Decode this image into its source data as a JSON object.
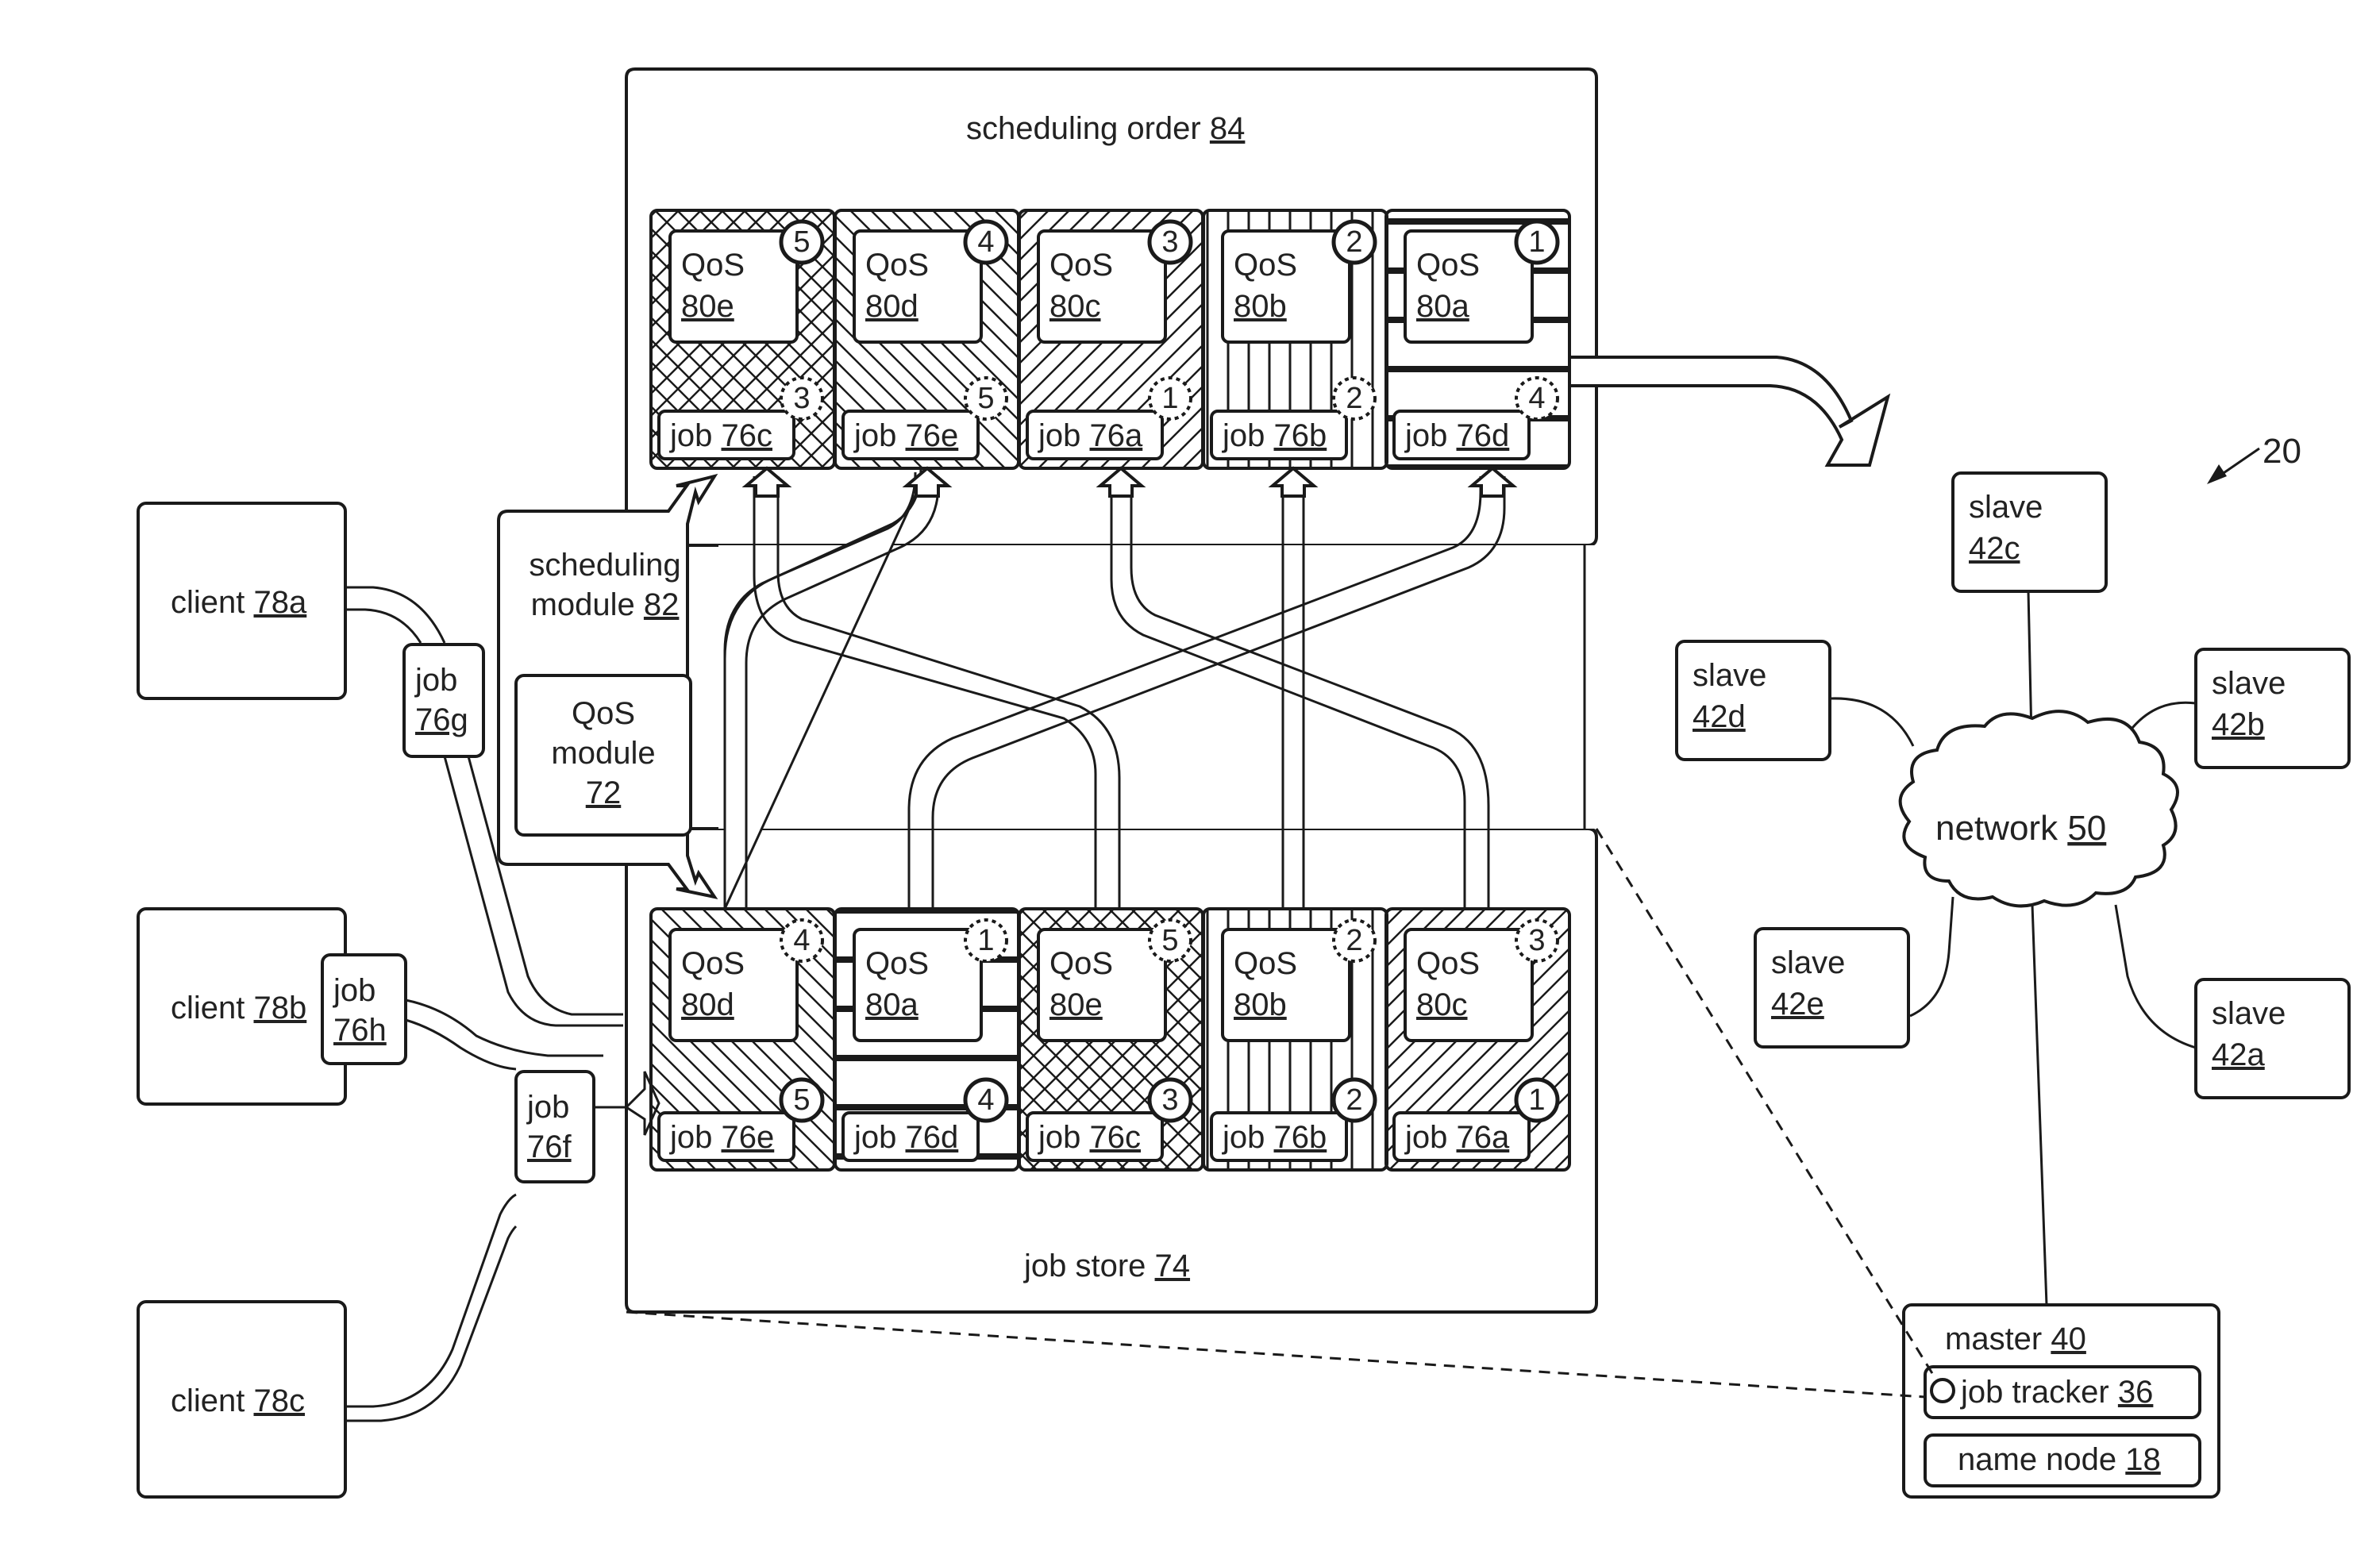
{
  "figure_number": "20",
  "scheduling_order": {
    "label": "scheduling order",
    "ref": "84",
    "cells": [
      {
        "qos": "QoS",
        "qos_ref": "80e",
        "qos_rank": "5",
        "job": "job",
        "job_ref": "76c",
        "job_rank": "3",
        "pattern": "crosshatch"
      },
      {
        "qos": "QoS",
        "qos_ref": "80d",
        "qos_rank": "4",
        "job": "job",
        "job_ref": "76e",
        "job_rank": "5",
        "pattern": "diag-back"
      },
      {
        "qos": "QoS",
        "qos_ref": "80c",
        "qos_rank": "3",
        "job": "job",
        "job_ref": "76a",
        "job_rank": "1",
        "pattern": "diag-fwd"
      },
      {
        "qos": "QoS",
        "qos_ref": "80b",
        "qos_rank": "2",
        "job": "job",
        "job_ref": "76b",
        "job_rank": "2",
        "pattern": "vertical"
      },
      {
        "qos": "QoS",
        "qos_ref": "80a",
        "qos_rank": "1",
        "job": "job",
        "job_ref": "76d",
        "job_rank": "4",
        "pattern": "horizontal"
      }
    ]
  },
  "job_store": {
    "label": "job store",
    "ref": "74",
    "cells": [
      {
        "qos": "QoS",
        "qos_ref": "80d",
        "qos_rank": "4",
        "job": "job",
        "job_ref": "76e",
        "job_rank": "5",
        "pattern": "diag-back"
      },
      {
        "qos": "QoS",
        "qos_ref": "80a",
        "qos_rank": "1",
        "job": "job",
        "job_ref": "76d",
        "job_rank": "4",
        "pattern": "horizontal"
      },
      {
        "qos": "QoS",
        "qos_ref": "80e",
        "qos_rank": "5",
        "job": "job",
        "job_ref": "76c",
        "job_rank": "3",
        "pattern": "crosshatch"
      },
      {
        "qos": "QoS",
        "qos_ref": "80b",
        "qos_rank": "2",
        "job": "job",
        "job_ref": "76b",
        "job_rank": "2",
        "pattern": "vertical"
      },
      {
        "qos": "QoS",
        "qos_ref": "80c",
        "qos_rank": "3",
        "job": "job",
        "job_ref": "76a",
        "job_rank": "1",
        "pattern": "diag-fwd"
      }
    ]
  },
  "scheduling_module": {
    "line1": "scheduling",
    "line2": "module",
    "ref": "82"
  },
  "qos_module": {
    "line1": "QoS",
    "line2": "module",
    "ref": "72"
  },
  "clients": [
    {
      "label": "client",
      "ref": "78a"
    },
    {
      "label": "client",
      "ref": "78b"
    },
    {
      "label": "client",
      "ref": "78c"
    }
  ],
  "incoming_jobs": [
    {
      "label": "job",
      "ref": "76g"
    },
    {
      "label": "job",
      "ref": "76h"
    },
    {
      "label": "job",
      "ref": "76f"
    }
  ],
  "network": {
    "label": "network",
    "ref": "50"
  },
  "slaves": [
    {
      "label": "slave",
      "ref": "42c"
    },
    {
      "label": "slave",
      "ref": "42d"
    },
    {
      "label": "slave",
      "ref": "42b"
    },
    {
      "label": "slave",
      "ref": "42e"
    },
    {
      "label": "slave",
      "ref": "42a"
    }
  ],
  "master": {
    "label": "master",
    "ref": "40",
    "job_tracker": {
      "label": "job tracker",
      "ref": "36"
    },
    "name_node": {
      "label": "name node",
      "ref": "18"
    }
  }
}
